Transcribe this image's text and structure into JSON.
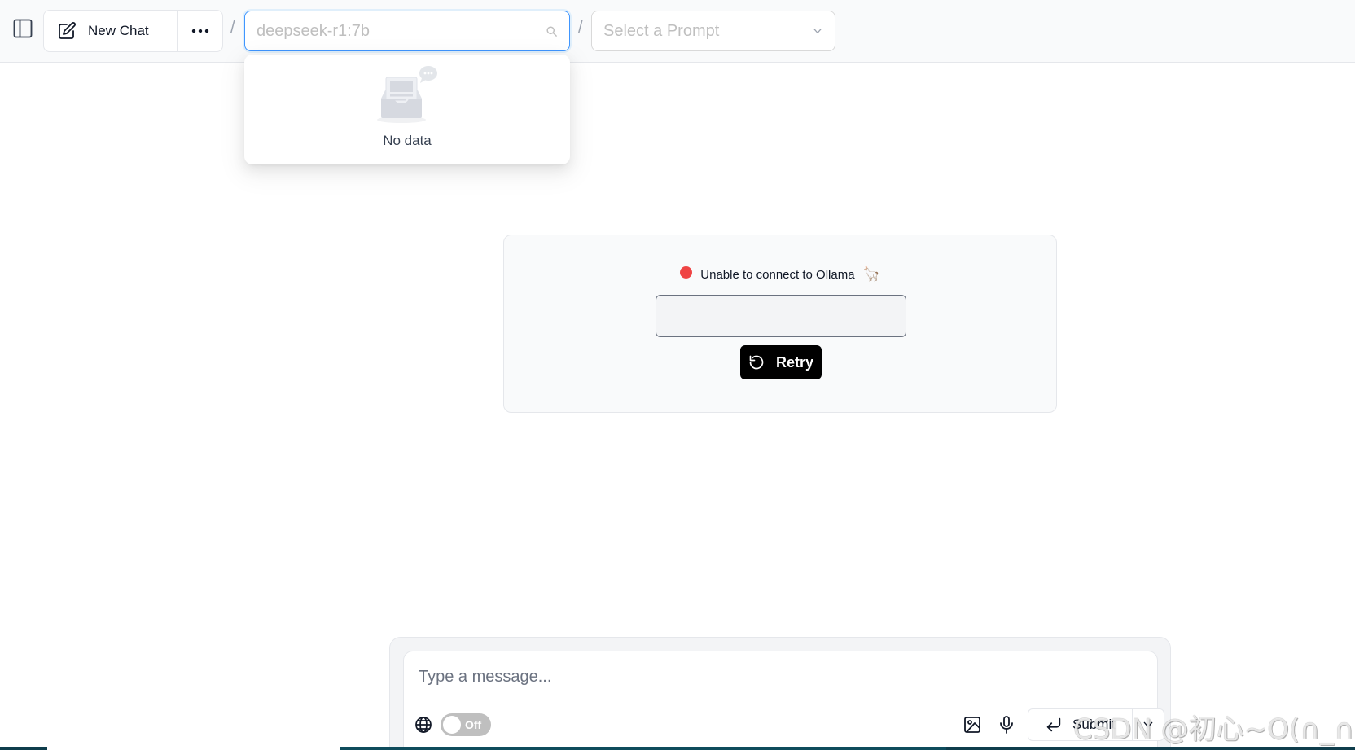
{
  "header": {
    "new_chat_label": "New Chat",
    "separator": "/",
    "model_select": {
      "placeholder": "deepseek-r1:7b",
      "value": ""
    },
    "prompt_select": {
      "placeholder": "Select a Prompt"
    }
  },
  "model_dropdown": {
    "empty_text": "No data"
  },
  "connection": {
    "status_text": "Unable to connect to Ollama",
    "emoji": "🦙",
    "status_color": "#ef4444",
    "url_value": "",
    "retry_label": "Retry"
  },
  "composer": {
    "placeholder": "Type a message...",
    "web_search_toggle": "Off",
    "submit_label": "Submit"
  },
  "watermark": "CSDN @初心~O(∩_∩)O",
  "colors": {
    "accent": "#4096ff",
    "retry_bg": "#000000",
    "header_bg": "#f9fafb"
  }
}
